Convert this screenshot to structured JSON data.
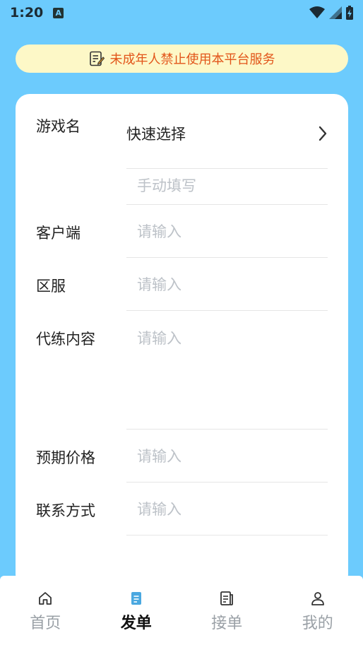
{
  "status": {
    "time": "1:20",
    "notification_letter": "A"
  },
  "notice": {
    "text": "未成年人禁止使用本平台服务"
  },
  "form": {
    "game_name_label": "游戏名",
    "quick_select": "快速选择",
    "manual_placeholder": "手动填写",
    "client_label": "客户端",
    "client_placeholder": "请输入",
    "server_label": "区服",
    "server_placeholder": "请输入",
    "content_label": "代练内容",
    "content_placeholder": "请输入",
    "price_label": "预期价格",
    "price_placeholder": "请输入",
    "contact_label": "联系方式",
    "contact_placeholder": "请输入"
  },
  "tabs": [
    {
      "label": "首页",
      "icon": "home-icon",
      "active": false
    },
    {
      "label": "发单",
      "icon": "post-order-icon",
      "active": true
    },
    {
      "label": "接单",
      "icon": "accept-order-icon",
      "active": false
    },
    {
      "label": "我的",
      "icon": "profile-icon",
      "active": false
    }
  ],
  "colors": {
    "background": "#6ccbfd",
    "notice_bg": "#fdf8c7",
    "notice_text": "#e2551a",
    "active_tab_icon": "#4aa8e0"
  }
}
